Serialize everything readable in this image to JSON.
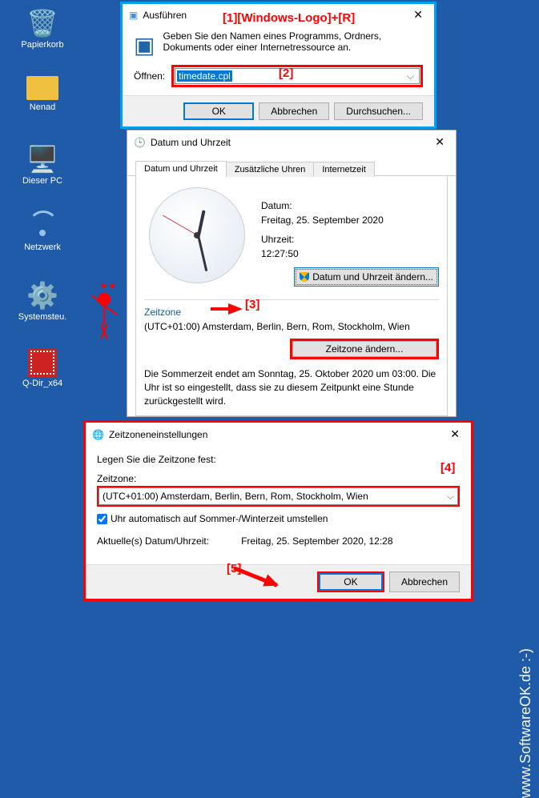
{
  "desktop": {
    "recycle_bin": "Papierkorb",
    "nenad": "Nenad",
    "this_pc": "Dieser PC",
    "network": "Netzwerk",
    "control_panel": "Systemsteu.",
    "qdir": "Q-Dir_x64"
  },
  "run": {
    "title": "Ausführen",
    "desc": "Geben Sie den Namen eines Programms, Ordners, Dokuments oder einer Internetressource an.",
    "open_label": "Öffnen:",
    "value": "timedate.cpl",
    "ok": "OK",
    "cancel": "Abbrechen",
    "browse": "Durchsuchen..."
  },
  "annot": {
    "a1": "[1][Windows-Logo]+[R]",
    "a2": "[2]",
    "a3": "[3]",
    "a4": "[4]",
    "a5": "[5]"
  },
  "dtime": {
    "title": "Datum und Uhrzeit",
    "tab1": "Datum und Uhrzeit",
    "tab2": "Zusätzliche Uhren",
    "tab3": "Internetzeit",
    "date_label": "Datum:",
    "date_value": "Freitag, 25. September 2020",
    "time_label": "Uhrzeit:",
    "time_value": "12:27:50",
    "change_dt": "Datum und Uhrzeit ändern...",
    "zone_hdr": "Zeitzone",
    "zone_text": "(UTC+01:00) Amsterdam, Berlin, Bern, Rom, Stockholm, Wien",
    "change_zone": "Zeitzone ändern...",
    "dst_text": "Die Sommerzeit endet am Sonntag, 25. Oktober 2020 um 03:00. Die Uhr ist so eingestellt, dass sie zu diesem Zeitpunkt eine Stunde zurückgestellt wird."
  },
  "tzset": {
    "title": "Zeitzoneneinstellungen",
    "prompt": "Legen Sie die Zeitzone fest:",
    "zone_label": "Zeitzone:",
    "zone_value": "(UTC+01:00) Amsterdam, Berlin, Bern, Rom, Stockholm, Wien",
    "dst_check": "Uhr automatisch auf Sommer-/Winterzeit umstellen",
    "now_label": "Aktuelle(s) Datum/Uhrzeit:",
    "now_value": "Freitag, 25. September 2020, 12:28",
    "ok": "OK",
    "cancel": "Abbrechen"
  },
  "watermark": "www.SoftwareOK.de :-)"
}
